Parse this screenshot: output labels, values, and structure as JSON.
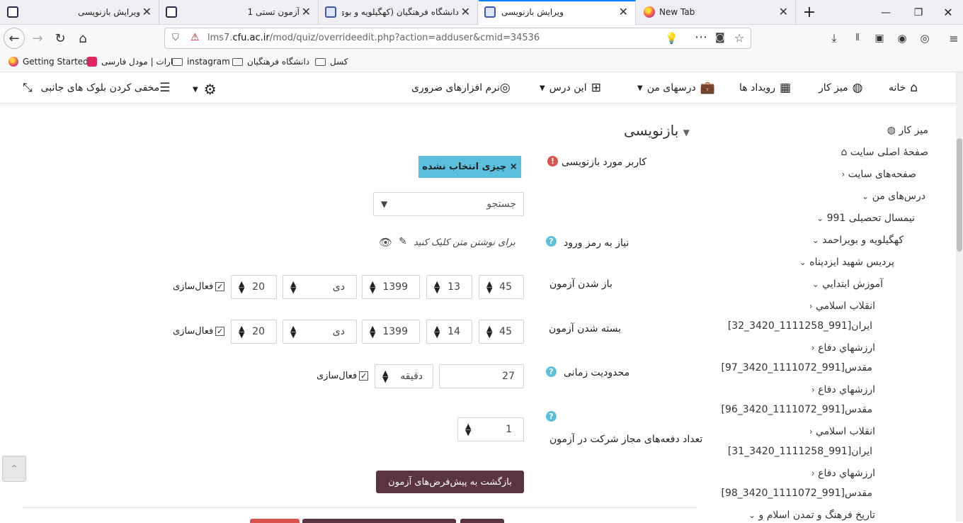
{
  "browser": {
    "tabs": [
      {
        "title": "ویرایش بازنویسی",
        "active": false
      },
      {
        "title": "آزمون تستی 1",
        "active": false
      },
      {
        "title": "دانشگاه فرهنگیان (کهگیلویه و بوی",
        "active": false
      },
      {
        "title": "ویرایش بازنویسی",
        "active": true
      },
      {
        "title": "New Tab",
        "active": false
      }
    ],
    "url_prefix": "lms7.",
    "url_domain": "cfu.ac.ir",
    "url_path": "/mod/quiz/overrideedit.php?action=adduser&cmid=34536",
    "bookmarks": [
      "Getting Started",
      "ارات | مودل فارسی",
      "instagram",
      "دانشگاه فرهنگیان",
      "کسل"
    ]
  },
  "moodle_nav": {
    "home": "خانه",
    "dashboard": "میز کار",
    "events": "رویداد ها",
    "my_courses": "درسهای من",
    "this_course": "این درس",
    "software": "نرم افزارهای ضروری",
    "hide_blocks": "مخفی کردن بلوک های جانبی"
  },
  "form": {
    "section_title": "بازنویسی",
    "user_label": "کاربر مورد بازنویسی",
    "no_selection": "× چیزی انتخاب نشده",
    "search_placeholder": "جستجو",
    "password_label": "نیاز به رمز ورود",
    "password_placeholder": "برای نوشتن متن کلیک کنید",
    "open_label": "باز شدن آزمون",
    "open": {
      "minute": "45",
      "day": "13",
      "year": "1399",
      "month": "دی",
      "hour": "20",
      "enable": "فعال‌سازی"
    },
    "close_label": "بسته شدن آزمون",
    "close": {
      "minute": "45",
      "day": "14",
      "year": "1399",
      "month": "دی",
      "hour": "20",
      "enable": "فعال‌سازی"
    },
    "timelimit_label": "محدودیت زمانی",
    "timelimit_value": "27",
    "timelimit_unit": "دقیقه",
    "timelimit_enable": "فعال‌سازی",
    "attempts_label": "تعداد دفعه‌های مجاز شرکت در آزمون",
    "attempts_value": "1",
    "revert_button": "بازگشت به پیش‌فرض‌های آزمون"
  },
  "sidebar": {
    "items": [
      "میز کار",
      "صفحهٔ اصلی سایت",
      "صفحه‌های سایت",
      "درس‌های من",
      "نیمسال تحصیلی 991",
      "کهگیلویه و بویراحمد",
      "پردیس شهید ایزدپناه",
      "آموزش ابتدایي",
      "انقلاب اسلامي",
      "ایران[991_1111258_3420_32]",
      "ارزشهاي دفاع",
      "مقدس[991_1111072_3420_97]",
      "ارزشهاي دفاع",
      "مقدس[991_1111072_3420_96]",
      "انقلاب اسلامي",
      "ایران[991_1111258_3420_31]",
      "ارزشهاي دفاع",
      "مقدس[991_1111072_3420_98]",
      "تاریخ فرهنگ و تمدن اسلام و"
    ]
  },
  "colors": {
    "accent": "#0a84ff",
    "select_badge": "#5bc0de",
    "revert_button": "#5a3541",
    "help_icon": "#5bc0de",
    "error_icon": "#d9534f"
  }
}
